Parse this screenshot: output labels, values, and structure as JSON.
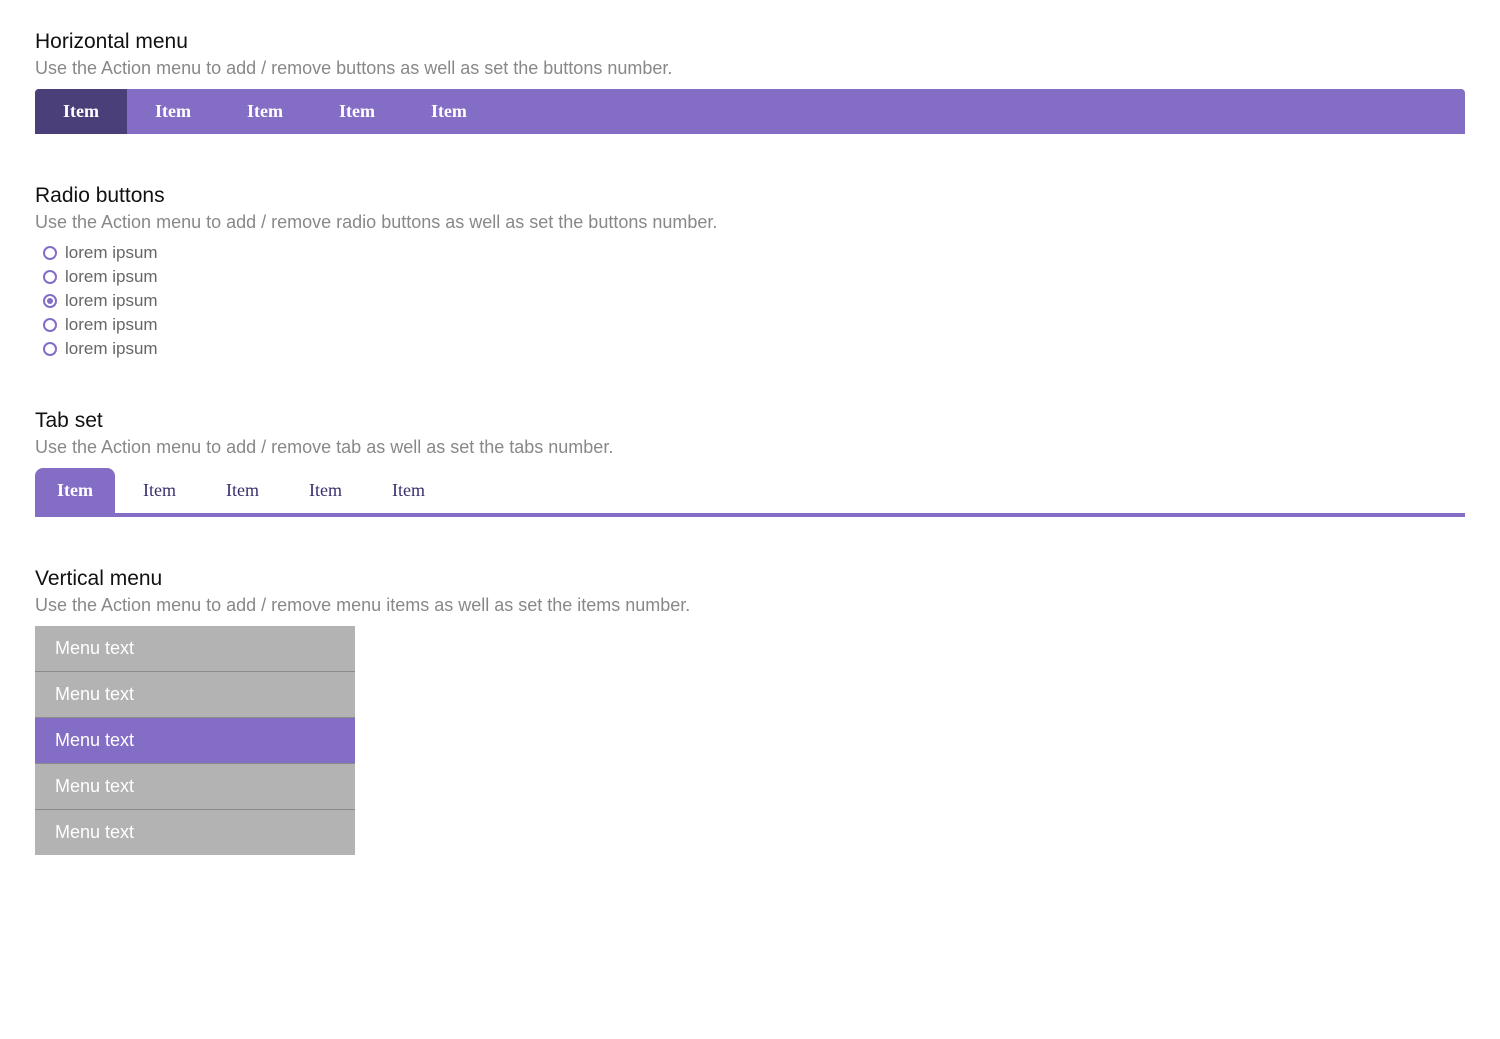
{
  "colors": {
    "accent": "#846dc4",
    "accent_dark": "#4b3f7a",
    "muted": "#b3b3b3",
    "desc_text": "#888888"
  },
  "horizontal_menu": {
    "title": "Horizontal menu",
    "desc": "Use the Action menu to add / remove buttons as well as set the buttons number.",
    "items": [
      {
        "label": "Item",
        "active": true
      },
      {
        "label": "Item",
        "active": false
      },
      {
        "label": "Item",
        "active": false
      },
      {
        "label": "Item",
        "active": false
      },
      {
        "label": "Item",
        "active": false
      }
    ]
  },
  "radio_buttons": {
    "title": "Radio buttons",
    "desc": "Use the Action menu to add / remove radio buttons as well as set the buttons number.",
    "items": [
      {
        "label": "lorem ipsum",
        "selected": false
      },
      {
        "label": "lorem ipsum",
        "selected": false
      },
      {
        "label": "lorem ipsum",
        "selected": true
      },
      {
        "label": "lorem ipsum",
        "selected": false
      },
      {
        "label": "lorem ipsum",
        "selected": false
      }
    ]
  },
  "tab_set": {
    "title": "Tab set",
    "desc": "Use the Action menu to add / remove tab as well as set the tabs number.",
    "items": [
      {
        "label": "Item",
        "active": true
      },
      {
        "label": "Item",
        "active": false
      },
      {
        "label": "Item",
        "active": false
      },
      {
        "label": "Item",
        "active": false
      },
      {
        "label": "Item",
        "active": false
      }
    ]
  },
  "vertical_menu": {
    "title": "Vertical menu",
    "desc": "Use the Action menu to add / remove menu items as well as set the items number.",
    "items": [
      {
        "label": "Menu text",
        "active": false
      },
      {
        "label": "Menu text",
        "active": false
      },
      {
        "label": "Menu text",
        "active": true
      },
      {
        "label": "Menu text",
        "active": false
      },
      {
        "label": "Menu text",
        "active": false
      }
    ]
  }
}
